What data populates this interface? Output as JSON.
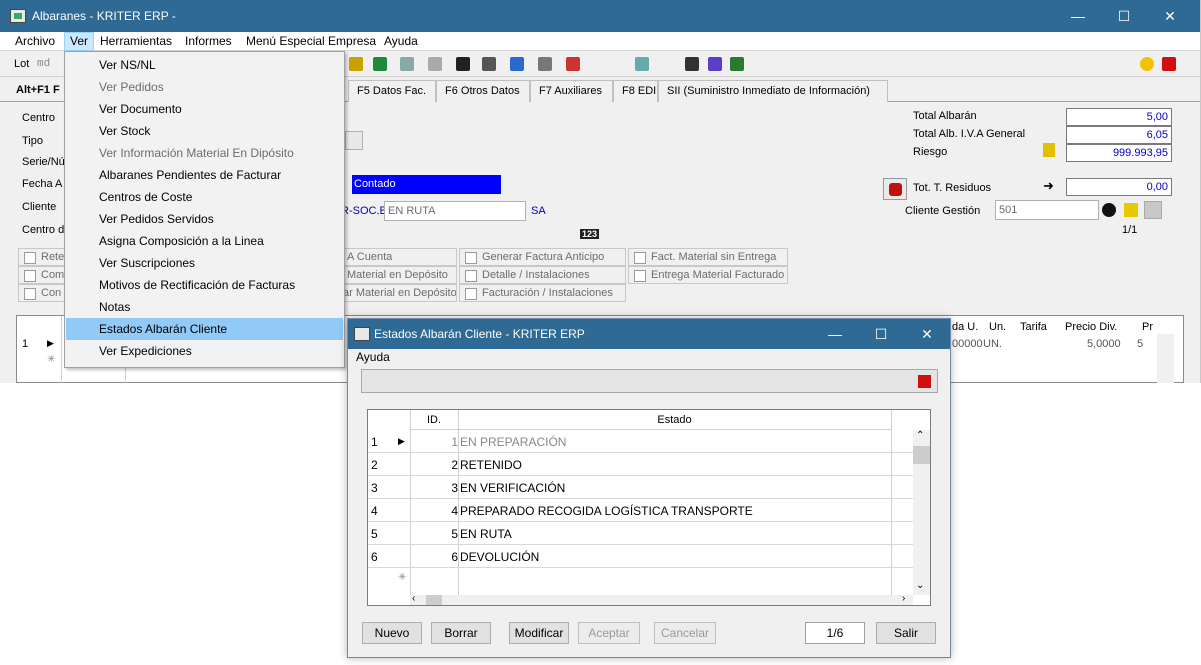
{
  "window": {
    "title": "Albaranes - KRITER ERP -",
    "controls": {
      "minimize": "—",
      "maximize": "☐",
      "close": "✕"
    }
  },
  "menubar": [
    "Archivo",
    "Ver",
    "Herramientas",
    "Informes",
    "Menú Especial Empresa",
    "Ayuda"
  ],
  "toolbar": {
    "lot_label": "Lot",
    "lot_value": "md"
  },
  "tabs": {
    "first": "Alt+F1 F",
    "items": [
      "F5 Datos Fac.",
      "F6 Otros Datos",
      "F7 Auxiliares",
      "F8 EDI",
      "SII (Suministro Inmediato de Información)"
    ]
  },
  "form": {
    "left_labels": [
      "Centro",
      "Tipo",
      "Serie/Nú",
      "Fecha A",
      "Cliente",
      "Centro d"
    ],
    "contado": "Contado",
    "soc_prefix": "R-SOC.E",
    "estado_combo": "EN RUTA",
    "sa": "SA",
    "code_badge": "123",
    "totals": [
      {
        "label": "Total Albarán",
        "value": "5,00"
      },
      {
        "label": "Total Alb. I.V.A General",
        "value": "6,05"
      },
      {
        "label": "Riesgo",
        "value": "999.993,95"
      }
    ],
    "residuos_label": "Tot. T. Residuos",
    "residuos_value": "0,00",
    "cliente_gestion_label": "Cliente Gestión",
    "cliente_gestion_value": "501",
    "pager": "1/1"
  },
  "checkboxes": {
    "col0": [
      "Rete",
      "Com",
      "Con"
    ],
    "col1": [
      "A Cuenta",
      "Material en Depósito",
      "ar Material en Depósito"
    ],
    "col2": [
      "Generar Factura Anticipo",
      "Detalle / Instalaciones",
      "Facturación / Instalaciones"
    ],
    "col3": [
      "Fact. Material sin Entrega",
      "Entrega Material Facturado"
    ]
  },
  "lines_grid": {
    "headers": [
      "da U.",
      "Un.",
      "Tarifa",
      "Precio Div.",
      "Pr"
    ],
    "row": {
      "num": "1",
      "qty": "00000",
      "unit": "UN.",
      "price": "5,0000",
      "pr": "5"
    }
  },
  "ver_menu": {
    "items": [
      {
        "label": "Ver NS/NL",
        "disabled": false
      },
      {
        "label": "Ver Pedidos",
        "disabled": true
      },
      {
        "label": "Ver Documento",
        "disabled": false
      },
      {
        "label": "Ver Stock",
        "disabled": false
      },
      {
        "label": "Ver Información Material En Dipósito",
        "disabled": true
      },
      {
        "label": "Albaranes Pendientes de Facturar",
        "disabled": false
      },
      {
        "label": "Centros de Coste",
        "disabled": false
      },
      {
        "label": "Ver Pedidos Servidos",
        "disabled": false
      },
      {
        "label": "Asigna Composición a la Linea",
        "disabled": false
      },
      {
        "label": "Ver Suscripciones",
        "disabled": false
      },
      {
        "label": "Motivos de Rectificación de Facturas",
        "disabled": false
      },
      {
        "label": "Notas",
        "disabled": false
      },
      {
        "label": "Estados Albarán Cliente",
        "disabled": false,
        "highlighted": true
      },
      {
        "label": "Ver Expediciones",
        "disabled": false
      }
    ]
  },
  "dialog": {
    "title": "Estados Albarán Cliente - KRITER ERP",
    "menu": "Ayuda",
    "columns": {
      "id": "ID.",
      "estado": "Estado"
    },
    "rows": [
      {
        "n": "1",
        "id": "1",
        "estado": "EN PREPARACIÓN"
      },
      {
        "n": "2",
        "id": "2",
        "estado": "RETENIDO"
      },
      {
        "n": "3",
        "id": "3",
        "estado": "EN VERIFICACIÓN"
      },
      {
        "n": "4",
        "id": "4",
        "estado": "PREPARADO RECOGIDA LOGÍSTICA TRANSPORTE"
      },
      {
        "n": "5",
        "id": "5",
        "estado": "EN RUTA"
      },
      {
        "n": "6",
        "id": "6",
        "estado": "DEVOLUCIÓN"
      }
    ],
    "buttons": {
      "nuevo": "Nuevo",
      "borrar": "Borrar",
      "modificar": "Modificar",
      "aceptar": "Aceptar",
      "cancelar": "Cancelar",
      "salir": "Salir"
    },
    "pager": "1/6"
  },
  "colors": {
    "titlebar": "#2e6a93",
    "highlight": "#91c9f7",
    "contado_bg": "#0000ff"
  }
}
